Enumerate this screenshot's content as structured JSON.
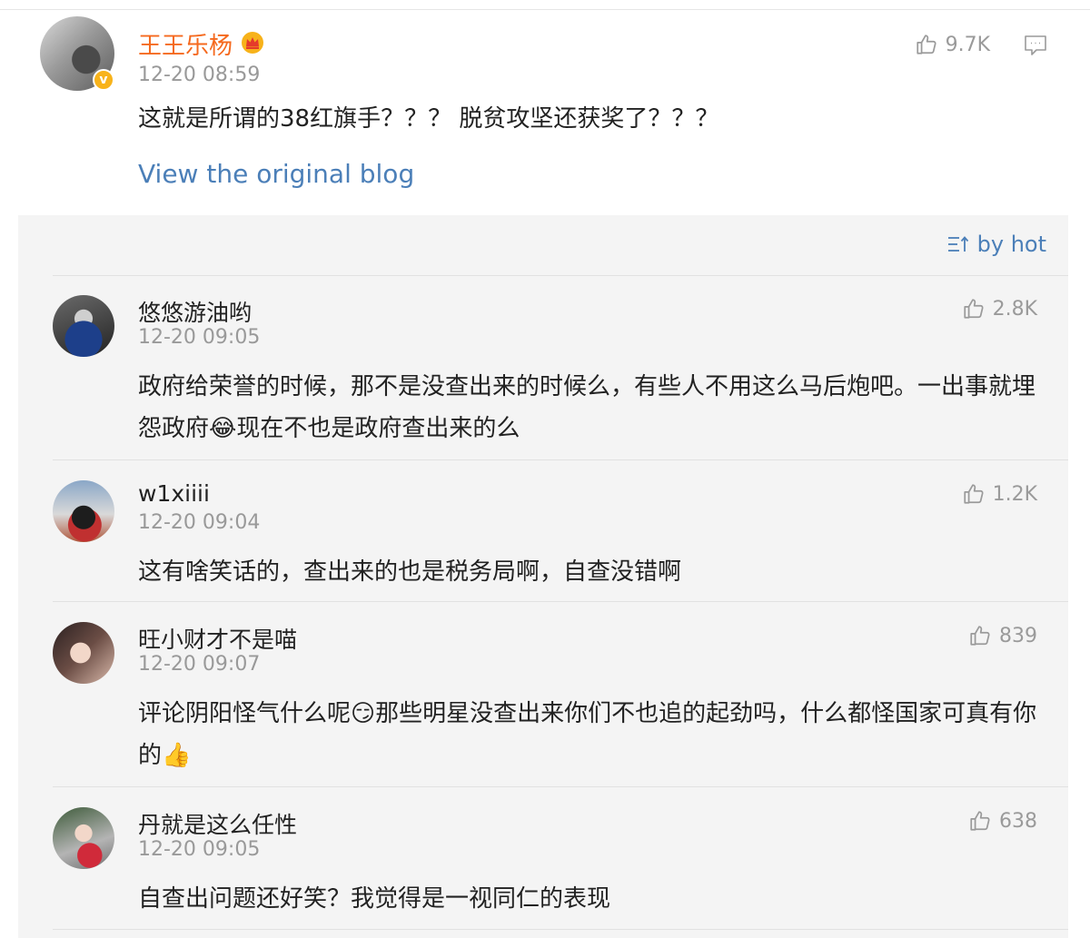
{
  "post": {
    "author": "王王乐杨",
    "time": "12-20 08:59",
    "likes": "9.7K",
    "text": "这就是所谓的38红旗手？？？ 脱贫攻坚还获奖了？？？",
    "view_original": "View the original blog"
  },
  "sort": {
    "label": "by hot"
  },
  "comments": [
    {
      "author": "悠悠游油哟",
      "time": "12-20 09:05",
      "likes": "2.8K",
      "text": "政府给荣誉的时候，那不是没查出来的时候么，有些人不用这么马后炮吧。一出事就埋怨政府😂现在不也是政府查出来的么"
    },
    {
      "author": "w1xiiii",
      "time": "12-20 09:04",
      "likes": "1.2K",
      "text": "这有啥笑话的，查出来的也是税务局啊，自查没错啊"
    },
    {
      "author": "旺小财才不是喵",
      "time": "12-20 09:07",
      "likes": "839",
      "text": "评论阴阳怪气什么呢😏那些明星没查出来你们不也追的起劲吗，什么都怪国家可真有你的👍"
    },
    {
      "author": "丹就是这么任性",
      "time": "12-20 09:05",
      "likes": "638",
      "text": "自查出问题还好笑？我觉得是一视同仁的表现"
    }
  ]
}
